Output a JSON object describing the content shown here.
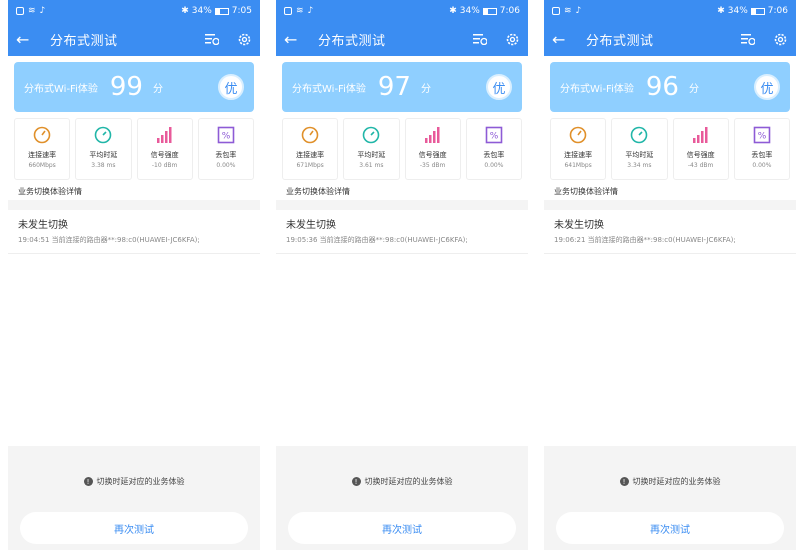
{
  "colors": {
    "appbar": "#3b8df2",
    "score_card": "#8fcfff",
    "speed_icon": "#e0902a",
    "latency_icon": "#21b6a8",
    "signal_icon": "#e85a9a",
    "loss_icon": "#8e5bd6"
  },
  "screens": [
    {
      "status": {
        "left_icons": [
          "sim-icon",
          "wifi-icon",
          "tiktok-icon"
        ],
        "battery": "34%",
        "time": "7:05"
      },
      "title": "分布式测试",
      "score": {
        "label": "分布式Wi-Fi体验",
        "value": "99",
        "unit": "分",
        "grade": "优"
      },
      "metrics": [
        {
          "icon": "speed-gauge-icon",
          "label": "连接速率",
          "value": "660Mbps"
        },
        {
          "icon": "latency-timer-icon",
          "label": "平均时延",
          "value": "3.38 ms"
        },
        {
          "icon": "signal-bars-icon",
          "label": "信号强度",
          "value": "-10 dBm"
        },
        {
          "icon": "percent-icon",
          "label": "丢包率",
          "value": "0.00%"
        }
      ],
      "section": "业务切换体验详情",
      "detail": {
        "title": "未发生切换",
        "text": "19:04:51 当前连接的路由器**:98:c0(HUAWEI-JC6KFA);"
      },
      "hint": "切换时延对应的业务体验",
      "retest": "再次测试"
    },
    {
      "status": {
        "left_icons": [
          "sim-icon",
          "wifi-icon",
          "tiktok-icon"
        ],
        "battery": "34%",
        "time": "7:06"
      },
      "title": "分布式测试",
      "score": {
        "label": "分布式Wi-Fi体验",
        "value": "97",
        "unit": "分",
        "grade": "优"
      },
      "metrics": [
        {
          "icon": "speed-gauge-icon",
          "label": "连接速率",
          "value": "671Mbps"
        },
        {
          "icon": "latency-timer-icon",
          "label": "平均时延",
          "value": "3.61 ms"
        },
        {
          "icon": "signal-bars-icon",
          "label": "信号强度",
          "value": "-35 dBm"
        },
        {
          "icon": "percent-icon",
          "label": "丢包率",
          "value": "0.00%"
        }
      ],
      "section": "业务切换体验详情",
      "detail": {
        "title": "未发生切换",
        "text": "19:05:36 当前连接的路由器**:98:c0(HUAWEI-JC6KFA);"
      },
      "hint": "切换时延对应的业务体验",
      "retest": "再次测试"
    },
    {
      "status": {
        "left_icons": [
          "sim-icon",
          "wifi-icon",
          "tiktok-icon"
        ],
        "battery": "34%",
        "time": "7:06"
      },
      "title": "分布式测试",
      "score": {
        "label": "分布式Wi-Fi体验",
        "value": "96",
        "unit": "分",
        "grade": "优"
      },
      "metrics": [
        {
          "icon": "speed-gauge-icon",
          "label": "连接速率",
          "value": "641Mbps"
        },
        {
          "icon": "latency-timer-icon",
          "label": "平均时延",
          "value": "3.34 ms"
        },
        {
          "icon": "signal-bars-icon",
          "label": "信号强度",
          "value": "-43 dBm"
        },
        {
          "icon": "percent-icon",
          "label": "丢包率",
          "value": "0.00%"
        }
      ],
      "section": "业务切换体验详情",
      "detail": {
        "title": "未发生切换",
        "text": "19:06:21 当前连接的路由器**:98:c0(HUAWEI-JC6KFA);"
      },
      "hint": "切换时延对应的业务体验",
      "retest": "再次测试"
    }
  ]
}
